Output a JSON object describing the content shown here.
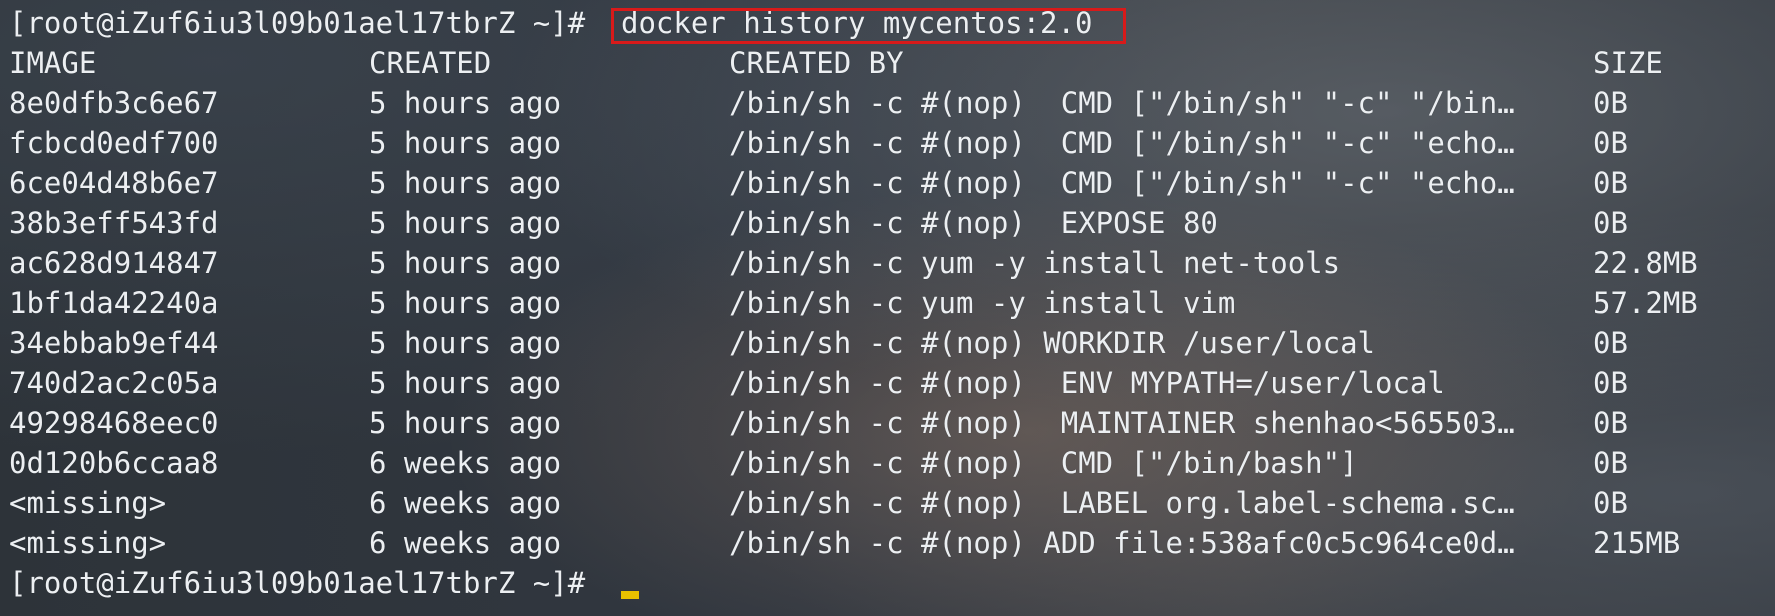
{
  "prompt": "[root@iZuf6iu3l09b01ael17tbrZ ~]#",
  "command": "docker history mycentos:2.0",
  "headers": {
    "image": "IMAGE",
    "created": "CREATED",
    "created_by": "CREATED BY",
    "size": "SIZE"
  },
  "rows": [
    {
      "image": "8e0dfb3c6e67",
      "created": "5 hours ago",
      "created_by": "/bin/sh -c #(nop)  CMD [\"/bin/sh\" \"-c\" \"/bin…",
      "size": "0B"
    },
    {
      "image": "fcbcd0edf700",
      "created": "5 hours ago",
      "created_by": "/bin/sh -c #(nop)  CMD [\"/bin/sh\" \"-c\" \"echo…",
      "size": "0B"
    },
    {
      "image": "6ce04d48b6e7",
      "created": "5 hours ago",
      "created_by": "/bin/sh -c #(nop)  CMD [\"/bin/sh\" \"-c\" \"echo…",
      "size": "0B"
    },
    {
      "image": "38b3eff543fd",
      "created": "5 hours ago",
      "created_by": "/bin/sh -c #(nop)  EXPOSE 80",
      "size": "0B"
    },
    {
      "image": "ac628d914847",
      "created": "5 hours ago",
      "created_by": "/bin/sh -c yum -y install net-tools",
      "size": "22.8MB"
    },
    {
      "image": "1bf1da42240a",
      "created": "5 hours ago",
      "created_by": "/bin/sh -c yum -y install vim",
      "size": "57.2MB"
    },
    {
      "image": "34ebbab9ef44",
      "created": "5 hours ago",
      "created_by": "/bin/sh -c #(nop) WORKDIR /user/local",
      "size": "0B"
    },
    {
      "image": "740d2ac2c05a",
      "created": "5 hours ago",
      "created_by": "/bin/sh -c #(nop)  ENV MYPATH=/user/local",
      "size": "0B"
    },
    {
      "image": "49298468eec0",
      "created": "5 hours ago",
      "created_by": "/bin/sh -c #(nop)  MAINTAINER shenhao<565503…",
      "size": "0B"
    },
    {
      "image": "0d120b6ccaa8",
      "created": "6 weeks ago",
      "created_by": "/bin/sh -c #(nop)  CMD [\"/bin/bash\"]",
      "size": "0B"
    },
    {
      "image": "<missing>",
      "created": "6 weeks ago",
      "created_by": "/bin/sh -c #(nop)  LABEL org.label-schema.sc…",
      "size": "0B"
    },
    {
      "image": "<missing>",
      "created": "6 weeks ago",
      "created_by": "/bin/sh -c #(nop) ADD file:538afc0c5c964ce0d…",
      "size": "215MB"
    }
  ],
  "colors": {
    "highlight_box": "#d81a1a",
    "cursor": "#e8c000",
    "text": "#eceff2"
  }
}
